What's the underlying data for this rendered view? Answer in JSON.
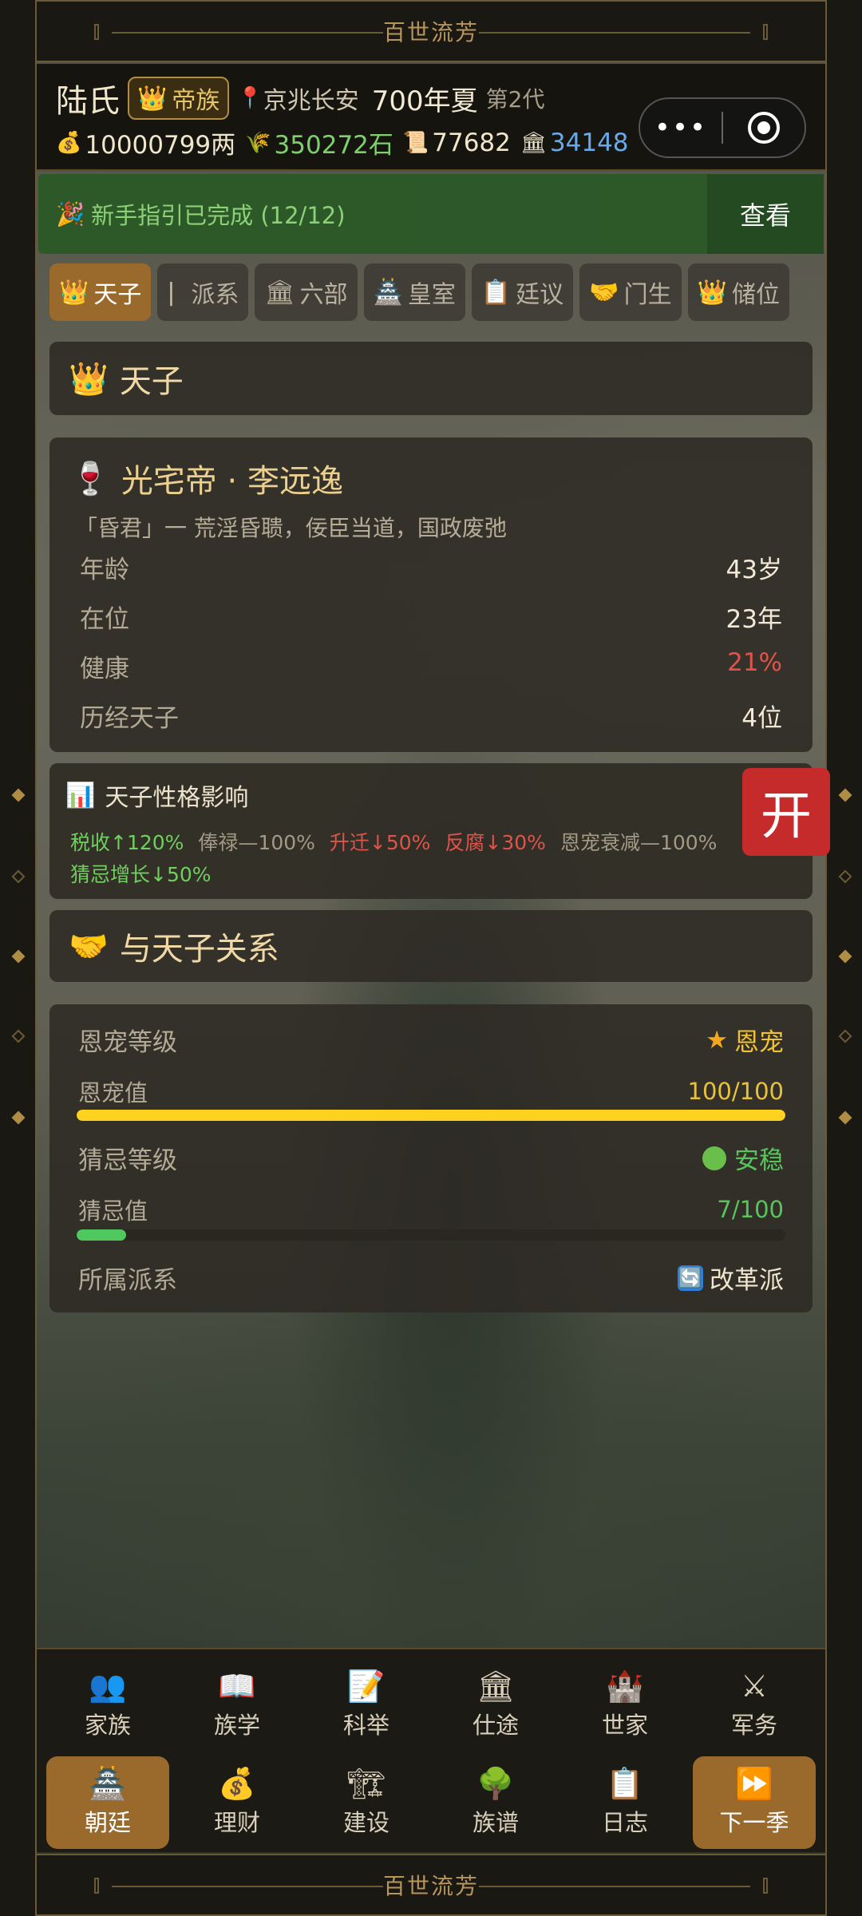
{
  "app": {
    "banner_title": "百世流芳"
  },
  "header": {
    "surname": "陆氏",
    "clan_badge": "帝族",
    "location": "京兆长安",
    "year": "700年夏",
    "generation": "第2代",
    "resources": {
      "money": "10000799两",
      "grain": "350272石",
      "scroll": "77682",
      "prestige": "34148"
    }
  },
  "guide": {
    "text": "新手指引已完成 (12/12)",
    "button": "查看"
  },
  "tabs": [
    {
      "label": "天子",
      "icon": "crown-icon",
      "active": true
    },
    {
      "label": "派系",
      "icon": "bar-icon",
      "active": false
    },
    {
      "label": "六部",
      "icon": "building-icon",
      "active": false
    },
    {
      "label": "皇室",
      "icon": "palace-icon",
      "active": false
    },
    {
      "label": "廷议",
      "icon": "clipboard-icon",
      "active": false
    },
    {
      "label": "门生",
      "icon": "handshake-icon",
      "active": false
    },
    {
      "label": "储位",
      "icon": "crown-icon",
      "active": false
    }
  ],
  "section_emperor": {
    "title": "天子"
  },
  "emperor": {
    "name": "光宅帝 · 李远逸",
    "description": "「昏君」一 荒淫昏聩，佞臣当道，国政废弛",
    "stats": [
      {
        "label": "年龄",
        "value": "43岁"
      },
      {
        "label": "在位",
        "value": "23年"
      },
      {
        "label": "健康",
        "value": "21%"
      },
      {
        "label": "历经天子",
        "value": "4位"
      }
    ]
  },
  "effects": {
    "title": "天子性格影响",
    "line1": [
      {
        "text": "税收↑120%",
        "tone": "green"
      },
      {
        "text": "俸禄—100%",
        "tone": "grey"
      },
      {
        "text": "升迁↓50%",
        "tone": "red"
      },
      {
        "text": "反腐↓30%",
        "tone": "red"
      },
      {
        "text": "恩宠衰减—100%",
        "tone": "grey"
      }
    ],
    "line2": [
      {
        "text": "猜忌增长↓50%",
        "tone": "green"
      }
    ]
  },
  "open_button": "开",
  "section_relation": {
    "title": "与天子关系"
  },
  "relation": {
    "favor_level_label": "恩宠等级",
    "favor_level_value": "恩宠",
    "favor_value_label": "恩宠值",
    "favor_value_text": "100/100",
    "favor_fraction": 1.0,
    "suspicion_level_label": "猜忌等级",
    "suspicion_level_value": "安稳",
    "suspicion_value_label": "猜忌值",
    "suspicion_value_text": "7/100",
    "suspicion_fraction": 0.07,
    "faction_label": "所属派系",
    "faction_value": "改革派"
  },
  "colors": {
    "gold": "#ffd21f",
    "green": "#4fc860",
    "red": "#e0534a",
    "accent": "#9a6a2c"
  },
  "nav": {
    "row1": [
      {
        "label": "家族",
        "icon": "family-icon"
      },
      {
        "label": "族学",
        "icon": "book-icon"
      },
      {
        "label": "科举",
        "icon": "memo-icon"
      },
      {
        "label": "仕途",
        "icon": "government-icon"
      },
      {
        "label": "世家",
        "icon": "castle-icon"
      },
      {
        "label": "军务",
        "icon": "swords-icon"
      }
    ],
    "row2": [
      {
        "label": "朝廷",
        "icon": "court-icon"
      },
      {
        "label": "理财",
        "icon": "money-bag-icon"
      },
      {
        "label": "建设",
        "icon": "crane-icon"
      },
      {
        "label": "族谱",
        "icon": "tree-icon"
      },
      {
        "label": "日志",
        "icon": "log-icon"
      },
      {
        "label": "下一季",
        "icon": "fast-forward-icon"
      }
    ]
  }
}
